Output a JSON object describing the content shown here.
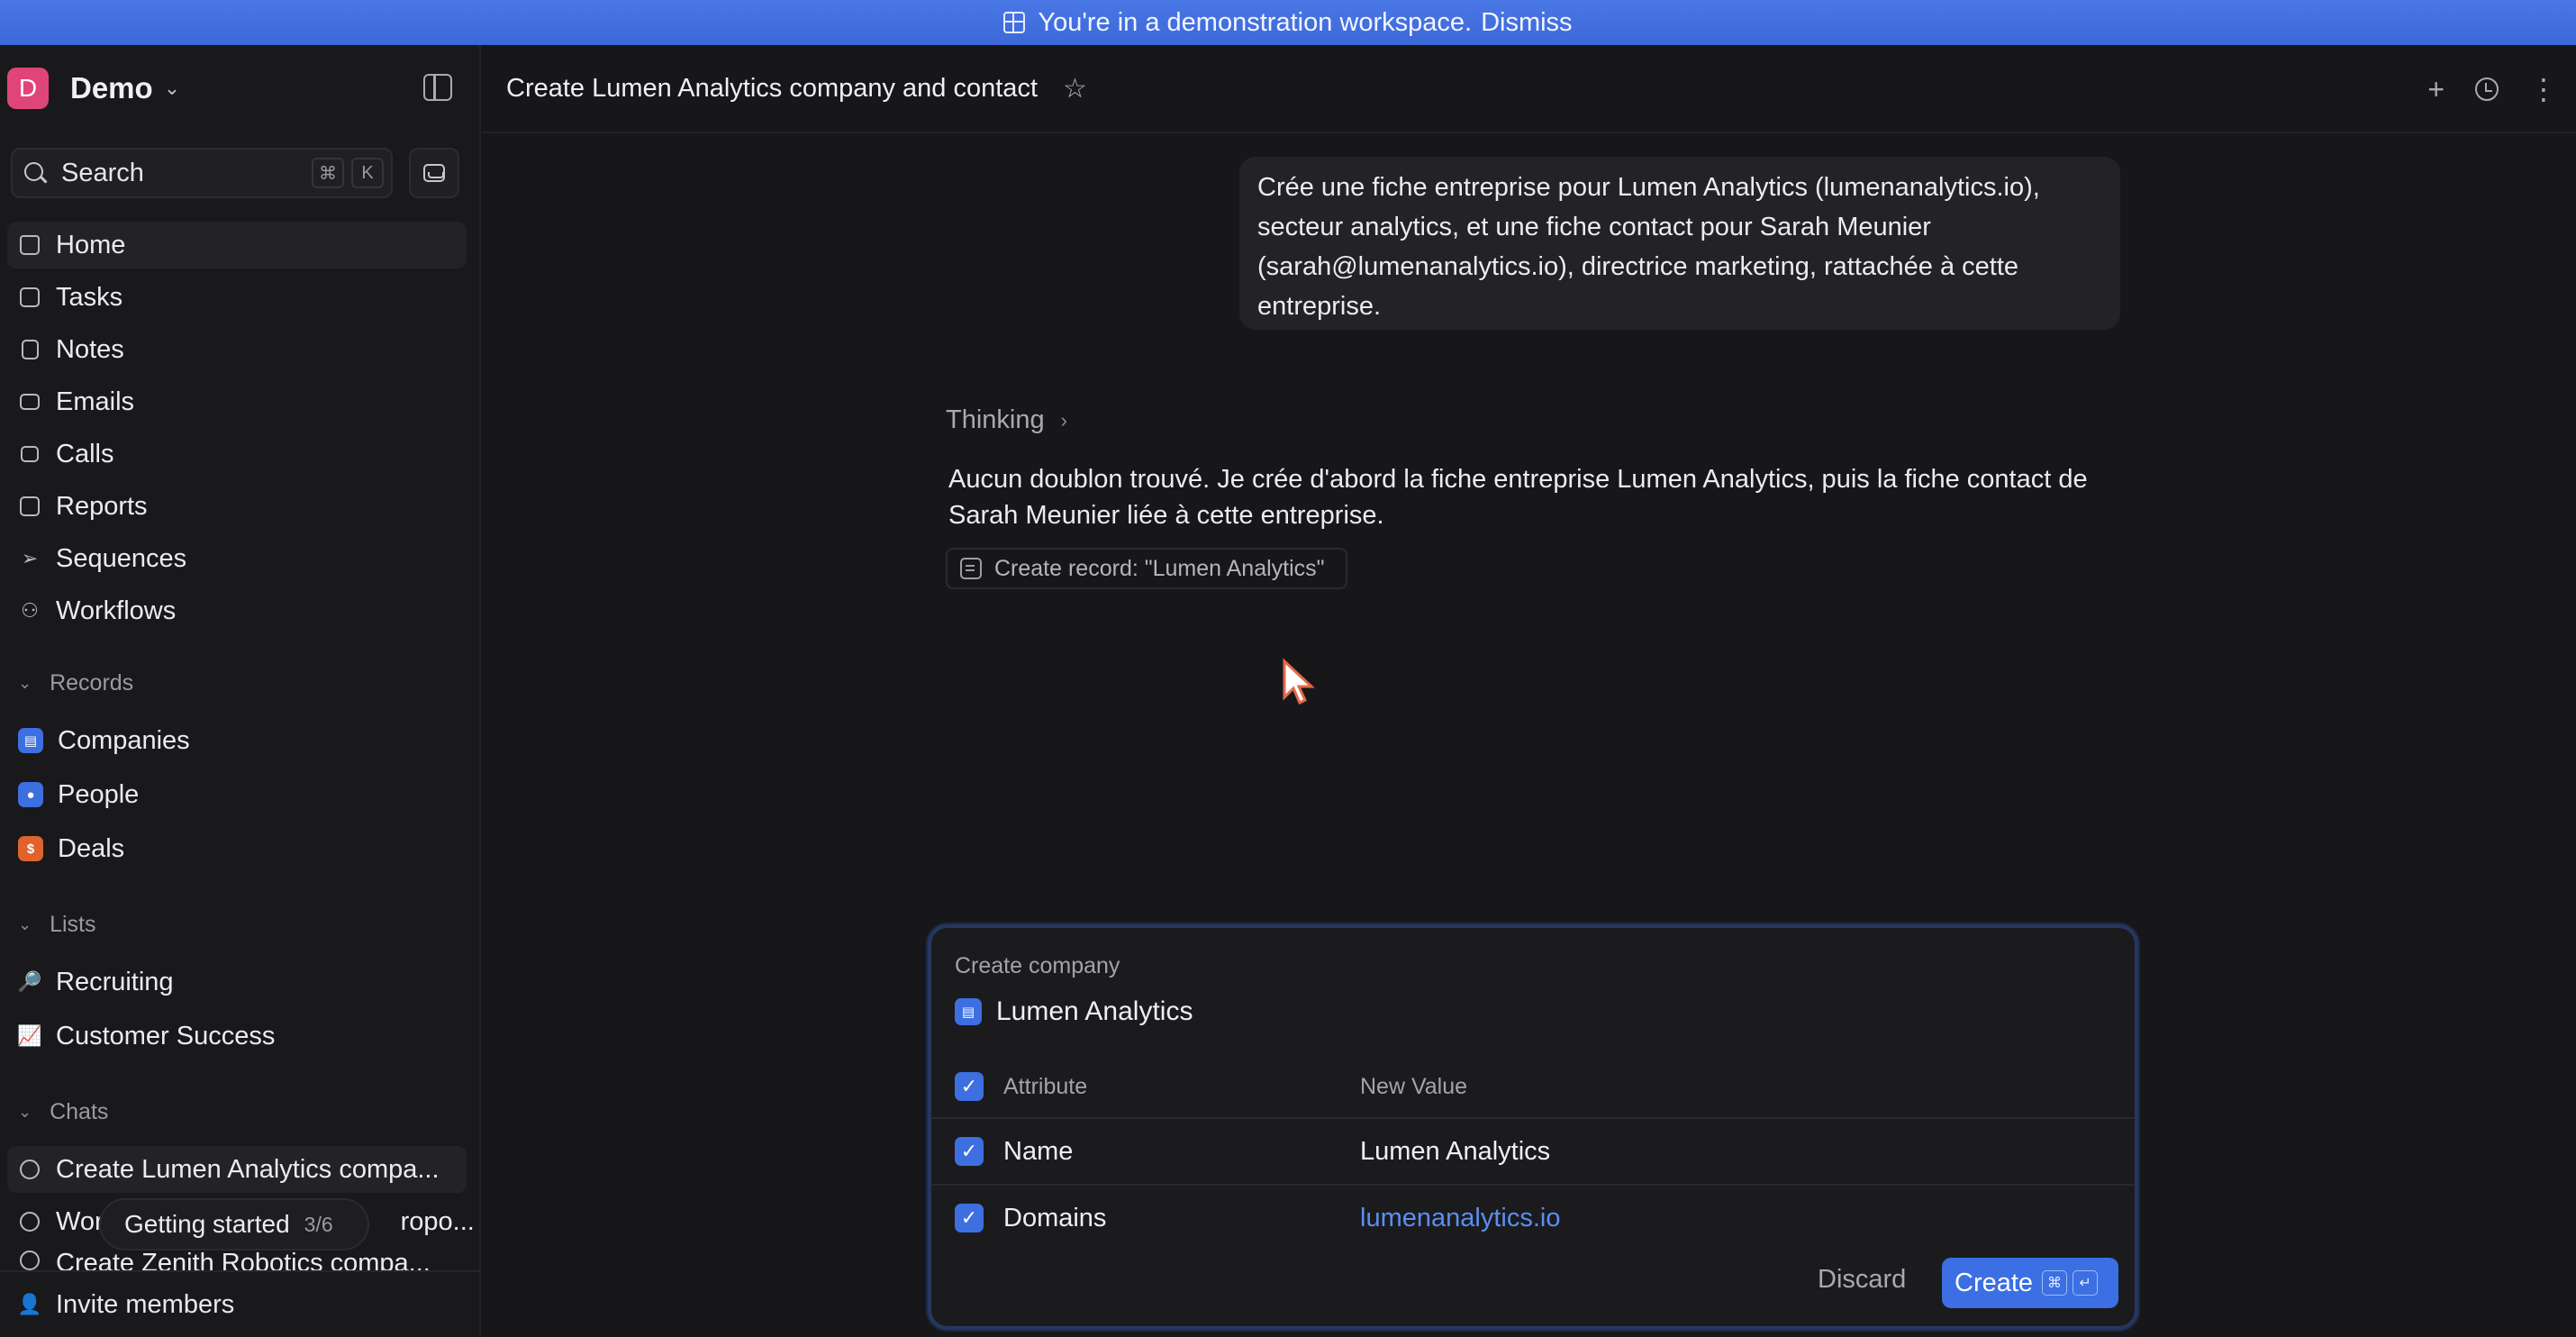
{
  "banner": {
    "text": "You're in a demonstration workspace.",
    "dismiss": "Dismiss"
  },
  "workspace": {
    "initial": "D",
    "name": "Demo"
  },
  "search": {
    "label": "Search",
    "kbd1": "⌘",
    "kbd2": "K"
  },
  "nav": [
    {
      "label": "Home"
    },
    {
      "label": "Tasks"
    },
    {
      "label": "Notes"
    },
    {
      "label": "Emails"
    },
    {
      "label": "Calls"
    },
    {
      "label": "Reports"
    },
    {
      "label": "Sequences"
    },
    {
      "label": "Workflows"
    }
  ],
  "records": {
    "title": "Records",
    "items": [
      {
        "label": "Companies",
        "color": "#3d6fe0"
      },
      {
        "label": "People",
        "color": "#3d6fe0"
      },
      {
        "label": "Deals",
        "color": "#e0632e"
      }
    ]
  },
  "lists": {
    "title": "Lists",
    "items": [
      {
        "label": "Recruiting",
        "emoji": "🔎"
      },
      {
        "label": "Customer Success",
        "emoji": "📈"
      }
    ]
  },
  "chats": {
    "title": "Chats",
    "items": [
      {
        "label": "Create Lumen Analytics compa..."
      },
      {
        "label_start": "Wor",
        "label_end": "ropo..."
      },
      {
        "label": "Create Zenith Robotics compa..."
      }
    ]
  },
  "getting_started": {
    "label": "Getting started",
    "count": "3/6"
  },
  "invite": "Invite members",
  "page": {
    "title": "Create Lumen Analytics company and contact"
  },
  "conversation": {
    "user_message": "Crée une fiche entreprise pour Lumen Analytics (lumenanalytics.io), secteur analytics, et une fiche contact pour Sarah Meunier (sarah@lumenanalytics.io), directrice marketing, rattachée à cette entreprise.",
    "thinking": "Thinking",
    "assistant_message": "Aucun doublon trouvé. Je crée d'abord la fiche entreprise Lumen Analytics, puis la fiche contact de Sarah Meunier liée à cette entreprise.",
    "tool_chip": "Create record: \"Lumen Analytics\""
  },
  "card": {
    "label": "Create company",
    "entity": "Lumen Analytics",
    "header": {
      "attribute": "Attribute",
      "new_value": "New Value"
    },
    "rows": [
      {
        "attribute": "Name",
        "value": "Lumen Analytics"
      },
      {
        "attribute": "Domains",
        "value": "lumenanalytics.io"
      }
    ],
    "discard": "Discard",
    "create": "Create",
    "create_kbd1": "⌘",
    "create_kbd2": "↵"
  },
  "colors": {
    "accent": "#3b6fe3",
    "banner": "#4a77e6",
    "avatar": "#e0457a"
  }
}
